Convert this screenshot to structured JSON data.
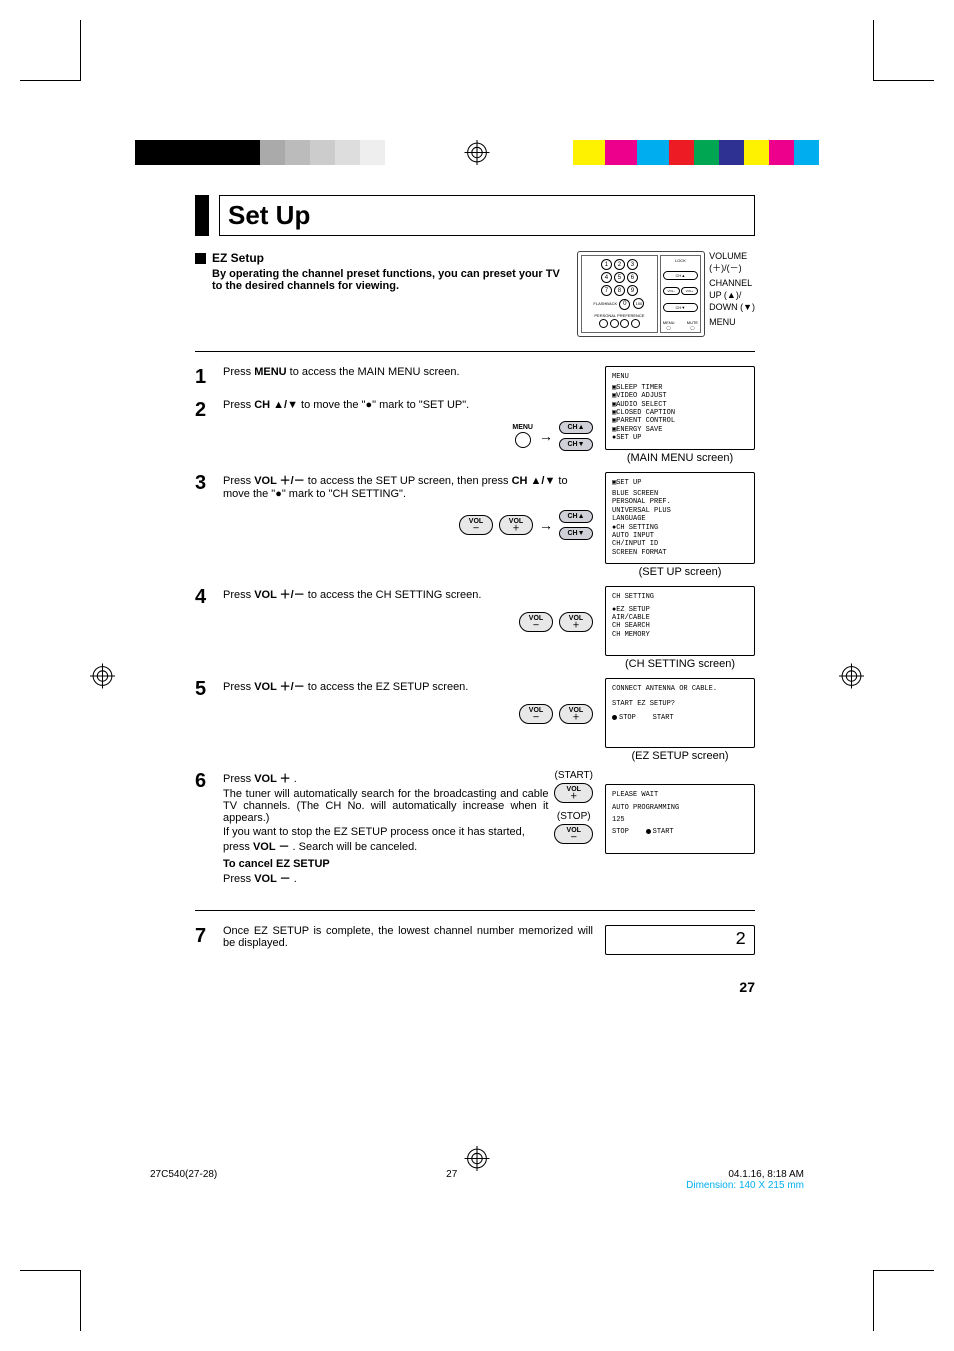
{
  "page": {
    "title": "Set Up",
    "section": {
      "heading": "EZ Setup",
      "desc": "By operating the channel preset functions, you can preset your TV to the desired channels for viewing."
    },
    "remote_labels": {
      "volume": "VOLUME",
      "volplusminus": "(＋)/(－)",
      "channel": "CHANNEL",
      "updown": "UP (▲)/\nDOWN (▼)",
      "menu": "MENU"
    },
    "steps": [
      {
        "num": "1",
        "text_pre": "Press ",
        "bold1": "MENU",
        "text_mid": " to access the MAIN MENU screen."
      },
      {
        "num": "2",
        "text_pre": "Press ",
        "bold1": "CH ▲/▼",
        "text_mid": " to move the \"●\" mark to \"SET UP\"."
      },
      {
        "num": "3",
        "text_pre": "Press ",
        "bold1": "VOL ＋/－",
        "text_mid": " to access the SET UP screen, then press ",
        "bold2": "CH ▲/▼",
        "text_end": " to move the \"●\" mark to \"CH SETTING\"."
      },
      {
        "num": "4",
        "text_pre": "Press ",
        "bold1": "VOL ＋/－",
        "text_mid": " to access the CH SETTING screen."
      },
      {
        "num": "5",
        "text_pre": "Press ",
        "bold1": "VOL ＋/－",
        "text_mid": " to access the EZ SETUP screen."
      },
      {
        "num": "6",
        "text_pre": "Press ",
        "bold1": "VOL ＋",
        "text_mid": " .",
        "line2": "The tuner will automatically search for the broadcasting and cable TV channels. (The CH No. will automatically increase when it appears.)",
        "line3_pre": "If you want to stop the EZ SETUP process once it has started, press ",
        "line3_bold": "VOL －",
        "line3_post": " . Search will be canceled.",
        "cancel_title": "To cancel EZ SETUP",
        "cancel_pre": "Press ",
        "cancel_bold": "VOL －",
        "cancel_post": " .",
        "start_label": "(START)",
        "stop_label": "(STOP)"
      },
      {
        "num": "7",
        "text": "Once EZ SETUP is complete, the lowest channel number memorized will be displayed."
      }
    ],
    "screens": {
      "main_menu": {
        "title": "MENU",
        "items": [
          "SLEEP TIMER",
          "VIDEO ADJUST",
          "AUDIO SELECT",
          "CLOSED CAPTION",
          "PARENT CONTROL",
          "ENERGY SAVE",
          "SET UP"
        ],
        "selected": 6,
        "caption": "(MAIN MENU screen)"
      },
      "setup": {
        "title": "SET UP",
        "items": [
          "BLUE SCREEN",
          "PERSONAL PREF.",
          "UNIVERSAL PLUS",
          "LANGUAGE",
          "CH SETTING",
          "AUTO INPUT",
          "CH/INPUT ID",
          "SCREEN FORMAT"
        ],
        "selected": 4,
        "caption": "(SET UP screen)"
      },
      "ch_setting": {
        "title": "CH SETTING",
        "items": [
          "EZ SETUP",
          "AIR/CABLE",
          "CH SEARCH",
          "CH MEMORY"
        ],
        "selected": 0,
        "caption": "(CH SETTING screen)"
      },
      "ez_setup": {
        "line1": "CONNECT ANTENNA OR CABLE.",
        "line2": "START EZ SETUP?",
        "options": [
          "STOP",
          "START"
        ],
        "selected": 0,
        "caption": "(EZ SETUP screen)"
      },
      "progress": {
        "line1": "PLEASE WAIT",
        "line2": "AUTO PROGRAMMING",
        "line3": "125",
        "options": [
          "STOP",
          "START"
        ],
        "selected": 1
      },
      "final": "2"
    },
    "buttons": {
      "menu": "MENU",
      "ch_up": "CH▲",
      "ch_down": "CH▼",
      "vol_plus_top": "VOL",
      "vol_plus_bot": "＋",
      "vol_minus_top": "VOL",
      "vol_minus_bot": "－"
    },
    "page_number": "27"
  },
  "footer": {
    "left": "27C540(27-28)",
    "center": "27",
    "right_time": "04.1.16, 8:18 AM",
    "dimension": "Dimension: 140  X 215 mm"
  }
}
